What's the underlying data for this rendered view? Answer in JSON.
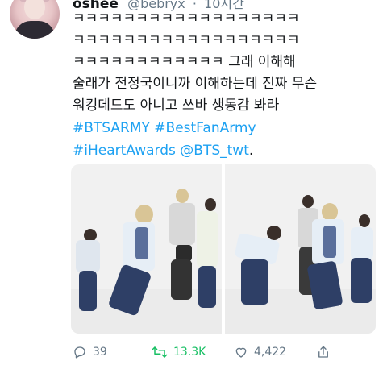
{
  "tweet": {
    "author_name": "oshee",
    "author_handle": "@bebryx",
    "time": "10시간",
    "text_lines": [
      "ㅋㅋㅋㅋㅋㅋㅋㅋㅋㅋㅋㅋㅋㅋㅋㅋㅋㅋ",
      "ㅋㅋㅋㅋㅋㅋㅋㅋㅋㅋㅋㅋㅋㅋㅋㅋㅋㅋ",
      "ㅋㅋㅋㅋㅋㅋㅋㅋㅋㅋㅋㅋ 그래 이해해",
      "술래가 전정국이니까 이해하는데 진짜 무슨",
      "워킹데드도 아니고 쓰바 생동감 봐라"
    ],
    "hashtags": [
      "#BTSARMY",
      "#BestFanArmy",
      "#iHeartAwards"
    ],
    "mention": "@BTS_twt",
    "trailing": "."
  },
  "actions": {
    "reply_count": "39",
    "retweet_count": "13.3K",
    "like_count": "4,422"
  },
  "icons": {
    "reply": "reply-icon",
    "retweet": "retweet-icon",
    "like": "heart-icon",
    "share": "share-icon"
  },
  "colors": {
    "link": "#1da1f2",
    "retweet_active": "#17bf63",
    "muted": "#657786"
  }
}
